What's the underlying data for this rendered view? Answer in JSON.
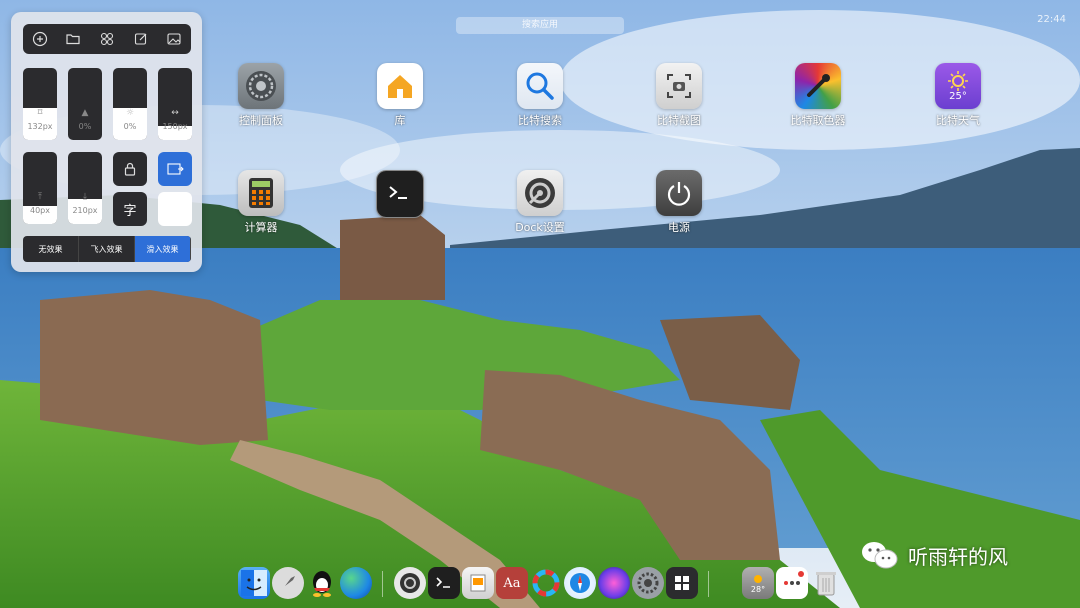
{
  "search": {
    "placeholder_text": "搜索应用"
  },
  "clock": {
    "text": "22:44"
  },
  "panel": {
    "toolbar": [
      "add-icon",
      "folder-icon",
      "apps-icon",
      "edit-icon",
      "image-icon"
    ],
    "sliders": [
      {
        "name": "icon-size",
        "value_label": "132px",
        "level": 0.45
      },
      {
        "name": "opacity",
        "value_label": "0%",
        "level": 0.0
      },
      {
        "name": "brightness",
        "value_label": "0%",
        "level": 0.45
      },
      {
        "name": "spacing",
        "value_label": "150px",
        "level": 0.2
      },
      {
        "name": "top-margin",
        "value_label": "40px",
        "level": 0.25
      },
      {
        "name": "bottom-margin",
        "value_label": "210px",
        "level": 0.35
      }
    ],
    "lock_icon": "lock-icon",
    "font_button_label": "字",
    "effects": [
      "无效果",
      "飞入效果",
      "滑入效果"
    ],
    "effects_active_index": 2
  },
  "apps": [
    {
      "label": "控制面板",
      "icon": "settings-gear-icon"
    },
    {
      "label": "库",
      "icon": "home-icon"
    },
    {
      "label": "比特搜索",
      "icon": "search-icon"
    },
    {
      "label": "比特截图",
      "icon": "screenshot-icon"
    },
    {
      "label": "比特取色器",
      "icon": "color-picker-icon"
    },
    {
      "label": "比特天气",
      "icon": "weather-icon",
      "temp": "25°"
    },
    {
      "label": "计算器",
      "icon": "calculator-icon"
    },
    {
      "label": "",
      "icon": "terminal-icon"
    },
    {
      "label": "Dock设置",
      "icon": "dock-settings-icon"
    },
    {
      "label": "电源",
      "icon": "power-icon"
    }
  ],
  "dock": {
    "weather_temp": "28°"
  },
  "watermark": {
    "text": "听雨轩的风"
  }
}
